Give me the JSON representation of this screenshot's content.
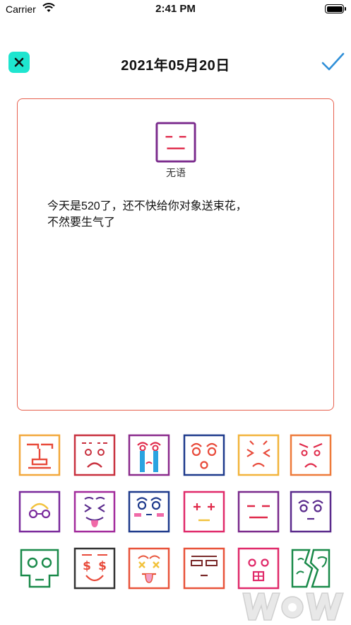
{
  "status_bar": {
    "carrier": "Carrier",
    "time": "2:41 PM",
    "battery_level": 1.0
  },
  "header": {
    "date": "2021年05月20日"
  },
  "mood": {
    "label": "无语"
  },
  "diary": {
    "line1": "今天是520了，还不快给你对象送束花，",
    "line2": "不然要生气了"
  },
  "colors": {
    "accent": "#1ee5cf",
    "check": "#2f8fd8",
    "card_border": "#e7604e"
  },
  "mood_grid": [
    "robot-face",
    "sad-face",
    "crying-face",
    "surprised-face",
    "wincing-face",
    "angry-face",
    "glasses-face",
    "tongue-face",
    "blushing-face",
    "plus-eyes-face",
    "speechless-face",
    "wide-eyes-face",
    "skull-face",
    "money-face",
    "dizzy-face",
    "flat-eyes-face",
    "tongue-block-face",
    "broken-face"
  ]
}
